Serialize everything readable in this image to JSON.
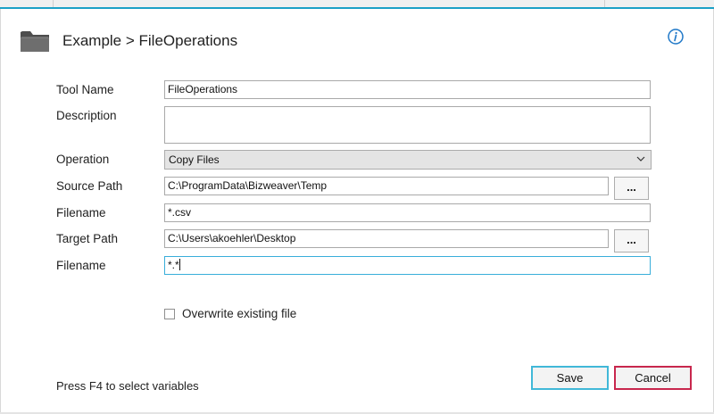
{
  "window": {
    "breadcrumb": "Example > FileOperations"
  },
  "icons": {
    "header": "folder-icon",
    "info": "info-icon",
    "dropdown": "chevron-down-icon"
  },
  "form": {
    "tool_name": {
      "label": "Tool Name",
      "value": "FileOperations"
    },
    "description": {
      "label": "Description",
      "value": ""
    },
    "operation": {
      "label": "Operation",
      "value": "Copy Files"
    },
    "source_path": {
      "label": "Source Path",
      "value": "C:\\ProgramData\\Bizweaver\\Temp",
      "browse_label": "..."
    },
    "source_filename": {
      "label": "Filename",
      "value": "*.csv"
    },
    "target_path": {
      "label": "Target Path",
      "value": "C:\\Users\\akoehler\\Desktop",
      "browse_label": "..."
    },
    "target_filename": {
      "label": "Filename",
      "value": "*.*"
    },
    "overwrite": {
      "label": "Overwrite existing file",
      "checked": false
    }
  },
  "footer": {
    "hint": "Press F4 to select variables",
    "save_label": "Save",
    "cancel_label": "Cancel"
  },
  "colors": {
    "accent": "#1ba1c7",
    "save_border": "#41b8d8",
    "cancel_border": "#c8274d",
    "info_blue": "#1f78c8"
  }
}
